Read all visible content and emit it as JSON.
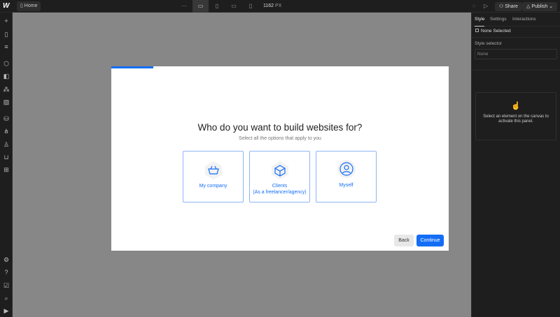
{
  "topbar": {
    "logo": "W",
    "page": "Home",
    "more": "···",
    "width_value": "1162",
    "width_unit": "PX",
    "share": "Share",
    "publish": "Publish"
  },
  "right_panel": {
    "tabs": [
      "Style",
      "Settings",
      "Interactions"
    ],
    "selection": "None Selected",
    "style_selector_label": "Style selector",
    "style_selector_value": "None",
    "empty_message": "Select an element on the canvas to activate this panel."
  },
  "modal": {
    "progress": 0.125,
    "title": "Who do you want to build websites for?",
    "subtitle": "Select all the options that apply to you",
    "options": [
      {
        "icon": "basket-icon",
        "label": "My company"
      },
      {
        "icon": "box-icon",
        "label": "Clients",
        "sublabel": "(As a freelancer/agency)"
      },
      {
        "icon": "user-icon",
        "label": "Myself"
      }
    ],
    "back": "Back",
    "continue": "Continue"
  },
  "colors": {
    "accent": "#146ef5",
    "canvas": "#878787",
    "chrome": "#1e1e1e"
  }
}
